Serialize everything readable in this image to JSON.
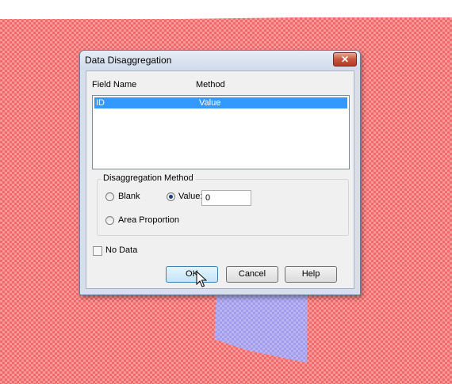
{
  "dialog": {
    "title": "Data Disaggregation",
    "close_glyph": "✕",
    "columns": {
      "field_name": "Field Name",
      "method": "Method"
    },
    "rows": [
      {
        "field_name": "ID",
        "method": "Value",
        "selected": true
      }
    ],
    "group": {
      "title": "Disaggregation Method",
      "options": {
        "blank": "Blank",
        "value": "Value:",
        "area_proportion": "Area Proportion"
      },
      "selected_option": "value",
      "value_input": "0"
    },
    "no_data": {
      "label": "No Data",
      "checked": false
    },
    "buttons": {
      "ok": "OK",
      "cancel": "Cancel",
      "help": "Help"
    }
  },
  "colors": {
    "map_fill": "#f06a6a",
    "polygon_fill": "#b9b4f2",
    "selection": "#3399ff"
  },
  "icons": {
    "close": "close-icon",
    "cursor": "mouse-pointer-icon"
  }
}
